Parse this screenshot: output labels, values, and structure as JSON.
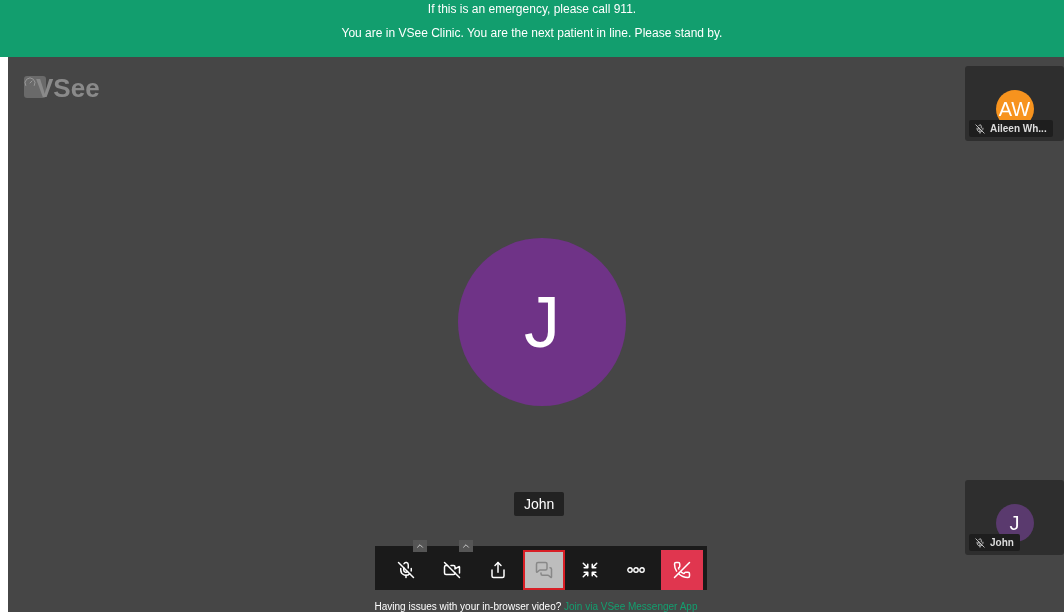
{
  "banner": {
    "lines": [
      "If this is an emergency, please call 911.",
      "You are in VSee Clinic. You are the next patient in line. Please stand by."
    ]
  },
  "logo": {
    "text": "VSee"
  },
  "main_participant": {
    "initial": "J",
    "color": "#6f3387",
    "name": "John"
  },
  "tiles": [
    {
      "initials": "AW",
      "color": "#f7931e",
      "name": "Aileen Wh...",
      "muted": true
    },
    {
      "initials": "J",
      "color": "#5a3a6e",
      "name": "John",
      "muted": true
    }
  ],
  "toolbar": [
    {
      "kind": "mic-off",
      "caret": true,
      "selected": false
    },
    {
      "kind": "camera-off",
      "caret": true,
      "selected": false
    },
    {
      "kind": "share",
      "caret": false,
      "selected": false
    },
    {
      "kind": "chat",
      "caret": false,
      "selected": true
    },
    {
      "kind": "shrink",
      "caret": false,
      "selected": false
    },
    {
      "kind": "more",
      "caret": false,
      "selected": false
    },
    {
      "kind": "hangup",
      "caret": false,
      "selected": false
    }
  ],
  "footer": {
    "text": "Having issues with your in-browser video?",
    "link": "Join via VSee Messenger App"
  }
}
